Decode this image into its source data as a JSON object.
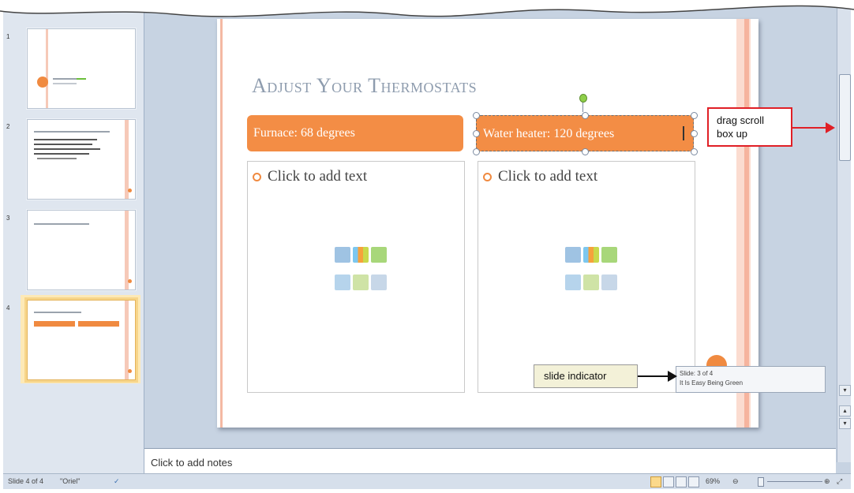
{
  "slide_pane": {
    "thumbnails": [
      {
        "number": "1"
      },
      {
        "number": "2"
      },
      {
        "number": "3"
      },
      {
        "number": "4",
        "selected": true
      }
    ]
  },
  "slide": {
    "title": "Adjust Your Thermostats",
    "header_left": "Furnace: 68 degrees",
    "header_right": "Water heater: 120 degrees",
    "placeholder_left": "Click to add text",
    "placeholder_right": "Click to add text"
  },
  "notes": {
    "placeholder": "Click to add notes"
  },
  "status_bar": {
    "slide_count": "Slide 4 of 4",
    "theme": "\"Oriel\"",
    "zoom_level": "69%"
  },
  "tooltip": {
    "line1": "Slide: 3 of 4",
    "line2": "It Is Easy Being Green"
  },
  "callouts": {
    "scroll": "drag scroll box up",
    "indicator": "slide indicator"
  },
  "colors": {
    "accent_orange": "#f38d45",
    "callout_red": "#e01f26",
    "selected_thumb": "#fbd98b"
  }
}
